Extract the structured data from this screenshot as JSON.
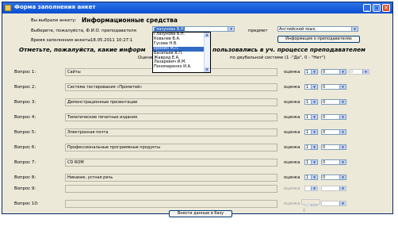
{
  "window": {
    "title": "Форма заполнения анкет"
  },
  "header": {
    "selected_label": "Вы выбрали анкету:",
    "selected_value": "Информационные средства",
    "teacher_prompt": "Выберите, пожалуйста, Ф.И.О. преподавателя",
    "teacher_value": "Глазунова В.Н.",
    "subject_label": "предмет",
    "subject_value": "Английский язык.",
    "time_label": "Время заполнения анкеты",
    "time_value": "18.05.2011 10:27:1",
    "info_button": "Информация о преподавателях"
  },
  "hint": {
    "left": "Отметьте, пожалуйста, какие информ",
    "right": "пользовались в уч. процессе преподавателем",
    "sub_left": "Оцените,",
    "sub_right": "по двубальной системе (1 -\"Да\", 0 - \"Нет\")"
  },
  "dropdown": {
    "items": [
      "Глазунова В.Н.",
      "Ковалев В.А.",
      "Гусева Н.В.",
      "Ерохин М.П.",
      "Васильев В.П.",
      "Жаврид Е.А.",
      "Лазаревич И.М.",
      "Пономаренко И.А."
    ],
    "highlighted_index": 3
  },
  "questions": [
    {
      "label": "Вопрос 1:",
      "text": "Сайты",
      "score_label": "оценка",
      "score": "1",
      "grade": "0",
      "extra": "0"
    },
    {
      "label": "Вопрос 2:",
      "text": "Система тестирования «Прометей»",
      "score_label": "оценка",
      "score": "1",
      "grade": "0"
    },
    {
      "label": "Вопрос 3:",
      "text": "Демонстрационные презентации",
      "score_label": "оценка",
      "score": "1",
      "grade": "0"
    },
    {
      "label": "Вопрос 4:",
      "text": "Тематические печатные издания",
      "score_label": "оценка",
      "score": "1",
      "grade": "0"
    },
    {
      "label": "Вопрос 5:",
      "text": "Электронная почта",
      "score_label": "оценка",
      "score": "1",
      "grade": "0"
    },
    {
      "label": "Вопрос 6:",
      "text": "Профессиональные программные продукты",
      "score_label": "оценка",
      "score": "1",
      "grade": "0"
    },
    {
      "label": "Вопрос 7:",
      "text": "CD ROM",
      "score_label": "оценка",
      "score": "1",
      "grade": "0"
    },
    {
      "label": "Вопрос 8:",
      "text": "Никакие, устная речь",
      "score_label": "оценка",
      "score": "1",
      "grade": "0"
    },
    {
      "label": "Вопрос 9:",
      "text": "",
      "score_label": "оценка",
      "score": "",
      "grade": ""
    },
    {
      "label": "Вопрос 10:",
      "text": "",
      "score_label": "оценка",
      "score": "",
      "grade": ""
    }
  ],
  "total": "0",
  "submit_button": "Внести данные в базу"
}
